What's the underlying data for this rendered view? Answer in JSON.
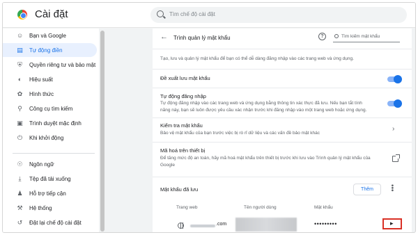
{
  "header": {
    "app_title": "Cài đặt",
    "search_placeholder": "Tìm chế độ cài đặt"
  },
  "sidebar": {
    "items": [
      {
        "label": "Bạn và Google",
        "icon": "person-icon"
      },
      {
        "label": "Tự động điền",
        "icon": "autofill-icon",
        "active": true
      },
      {
        "label": "Quyền riêng tư và bảo mật",
        "icon": "shield-icon"
      },
      {
        "label": "Hiệu suất",
        "icon": "speedometer-icon"
      },
      {
        "label": "Hình thức",
        "icon": "palette-icon"
      },
      {
        "label": "Công cụ tìm kiếm",
        "icon": "search-icon"
      },
      {
        "label": "Trình duyệt mặc định",
        "icon": "browser-icon"
      },
      {
        "label": "Khi khởi động",
        "icon": "power-icon"
      },
      {
        "label": "Ngôn ngữ",
        "icon": "globe-icon"
      },
      {
        "label": "Tệp đã tải xuống",
        "icon": "download-icon"
      },
      {
        "label": "Hỗ trợ tiếp cận",
        "icon": "accessibility-icon"
      },
      {
        "label": "Hệ thống",
        "icon": "wrench-icon"
      },
      {
        "label": "Đặt lại chế độ cài đặt",
        "icon": "reset-icon"
      }
    ]
  },
  "password_manager": {
    "title": "Trình quản lý mật khẩu",
    "search_placeholder": "Tìm kiếm mật khẩu",
    "intro": "Tạo, lưu và quản lý mật khẩu để bạn có thể dễ dàng đăng nhập vào các trang web và ứng dụng.",
    "offer_save": {
      "title": "Đề xuất lưu mật khẩu",
      "enabled": true
    },
    "auto_signin": {
      "title": "Tự động đăng nhập",
      "desc1": "Tự động đăng nhập vào các trang web và ứng dụng bằng thông tin xác thực đã lưu. Nếu bạn tắt tính",
      "desc2": "năng này, bạn sẽ luôn được yêu cầu xác nhận trước khi đăng nhập vào một trang web hoặc ứng dụng.",
      "enabled": true
    },
    "check": {
      "title": "Kiểm tra mật khẩu",
      "desc": "Bảo vệ mật khẩu của bạn trước việc bị rò rỉ dữ liệu và các vấn đề bảo mật khác"
    },
    "device_encryption": {
      "title": "Mã hoá trên thiết bị",
      "desc1": "Để tăng mức độ an toàn, hãy mã hoá mật khẩu trên thiết bị trước khi lưu vào Trình quản lý mật khẩu của",
      "desc2": "Google"
    },
    "saved": {
      "title": "Mật khẩu đã lưu",
      "add_label": "Thêm",
      "columns": [
        "Trang web",
        "Tên người dùng",
        "Mật khẩu"
      ],
      "rows": [
        {
          "site": ".com",
          "site_prefix": "ummmmmm",
          "password_mask": "•••••••••"
        }
      ]
    }
  },
  "colors": {
    "accent": "#1a73e8",
    "active_bg": "#e8f0fe",
    "highlight_border": "#d93025"
  }
}
